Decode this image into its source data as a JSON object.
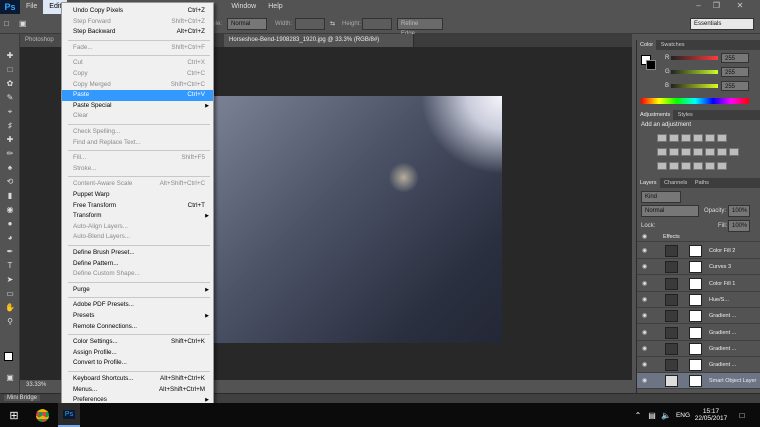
{
  "app": {
    "logo": "Ps"
  },
  "menubar": {
    "items": [
      "File",
      "Edit",
      "Window",
      "Help"
    ]
  },
  "options_bar": {
    "style_label": "Style:",
    "style_value": "Normal",
    "width_label": "Width:",
    "height_label": "Height:",
    "refine_edge": "Refine Edge...",
    "workspace": "Essentials"
  },
  "tabs": {
    "first": "Photoshop",
    "document": "Horseshoe-Bend-1908283_1920.jpg @ 33.3% (RGB/8#)"
  },
  "status": {
    "zoom": "33.33%",
    "mini_bridge": "Mini Bridge"
  },
  "edit_menu": {
    "groups": [
      [
        {
          "label": "Undo Copy Pixels",
          "shortcut": "Ctrl+Z",
          "enabled": true
        },
        {
          "label": "Step Forward",
          "shortcut": "Shift+Ctrl+Z",
          "enabled": false
        },
        {
          "label": "Step Backward",
          "shortcut": "Alt+Ctrl+Z",
          "enabled": true
        }
      ],
      [
        {
          "label": "Fade...",
          "shortcut": "Shift+Ctrl+F",
          "enabled": false
        }
      ],
      [
        {
          "label": "Cut",
          "shortcut": "Ctrl+X",
          "enabled": false
        },
        {
          "label": "Copy",
          "shortcut": "Ctrl+C",
          "enabled": false
        },
        {
          "label": "Copy Merged",
          "shortcut": "Shift+Ctrl+C",
          "enabled": false
        },
        {
          "label": "Paste",
          "shortcut": "Ctrl+V",
          "enabled": true,
          "highlighted": true
        },
        {
          "label": "Paste Special",
          "submenu": true,
          "enabled": true
        },
        {
          "label": "Clear",
          "enabled": false
        }
      ],
      [
        {
          "label": "Check Spelling...",
          "enabled": false
        },
        {
          "label": "Find and Replace Text...",
          "enabled": false
        }
      ],
      [
        {
          "label": "Fill...",
          "shortcut": "Shift+F5",
          "enabled": false
        },
        {
          "label": "Stroke...",
          "enabled": false
        }
      ],
      [
        {
          "label": "Content-Aware Scale",
          "shortcut": "Alt+Shift+Ctrl+C",
          "enabled": false
        },
        {
          "label": "Puppet Warp",
          "enabled": true
        },
        {
          "label": "Free Transform",
          "shortcut": "Ctrl+T",
          "enabled": true
        },
        {
          "label": "Transform",
          "submenu": true,
          "enabled": true
        },
        {
          "label": "Auto-Align Layers...",
          "enabled": false
        },
        {
          "label": "Auto-Blend Layers...",
          "enabled": false
        }
      ],
      [
        {
          "label": "Define Brush Preset...",
          "enabled": true
        },
        {
          "label": "Define Pattern...",
          "enabled": true
        },
        {
          "label": "Define Custom Shape...",
          "enabled": false
        }
      ],
      [
        {
          "label": "Purge",
          "submenu": true,
          "enabled": true
        }
      ],
      [
        {
          "label": "Adobe PDF Presets...",
          "enabled": true
        },
        {
          "label": "Presets",
          "submenu": true,
          "enabled": true
        },
        {
          "label": "Remote Connections...",
          "enabled": true
        }
      ],
      [
        {
          "label": "Color Settings...",
          "shortcut": "Shift+Ctrl+K",
          "enabled": true
        },
        {
          "label": "Assign Profile...",
          "enabled": true
        },
        {
          "label": "Convert to Profile...",
          "enabled": true
        }
      ],
      [
        {
          "label": "Keyboard Shortcuts...",
          "shortcut": "Alt+Shift+Ctrl+K",
          "enabled": true
        },
        {
          "label": "Menus...",
          "shortcut": "Alt+Shift+Ctrl+M",
          "enabled": true
        },
        {
          "label": "Preferences",
          "submenu": true,
          "enabled": true
        }
      ]
    ]
  },
  "panels": {
    "color_tabs": [
      "Color",
      "Swatches"
    ],
    "color_channels": [
      {
        "name": "R",
        "value": "255",
        "color": "#ff3b3b"
      },
      {
        "name": "G",
        "value": "255",
        "color": "#c7ff2e"
      },
      {
        "name": "B",
        "value": "255",
        "color": "#d7ff1f"
      }
    ],
    "adjustments_tabs": [
      "Adjustments",
      "Styles"
    ],
    "adjustments_title": "Add an adjustment",
    "layers_tabs": [
      "Layers",
      "Channels",
      "Paths"
    ],
    "kind_label": "Kind",
    "blend_mode": "Normal",
    "opacity_label": "Opacity:",
    "opacity_value": "100%",
    "lock_label": "Lock:",
    "fill_label": "Fill:",
    "fill_value": "100%",
    "layers": [
      {
        "name": "Effects",
        "group": true
      },
      {
        "name": "Color Fill 2"
      },
      {
        "name": "Curves 3"
      },
      {
        "name": "Color Fill 1"
      },
      {
        "name": "Hue/S..."
      },
      {
        "name": "Gradient ..."
      },
      {
        "name": "Gradient ..."
      },
      {
        "name": "Gradient ..."
      },
      {
        "name": "Gradient ..."
      },
      {
        "name": "Smart Object Layer",
        "selected": true
      }
    ]
  },
  "taskbar": {
    "lang": "ENG",
    "time": "15:17",
    "date": "22/05/2017",
    "ps_label": "Ps"
  }
}
